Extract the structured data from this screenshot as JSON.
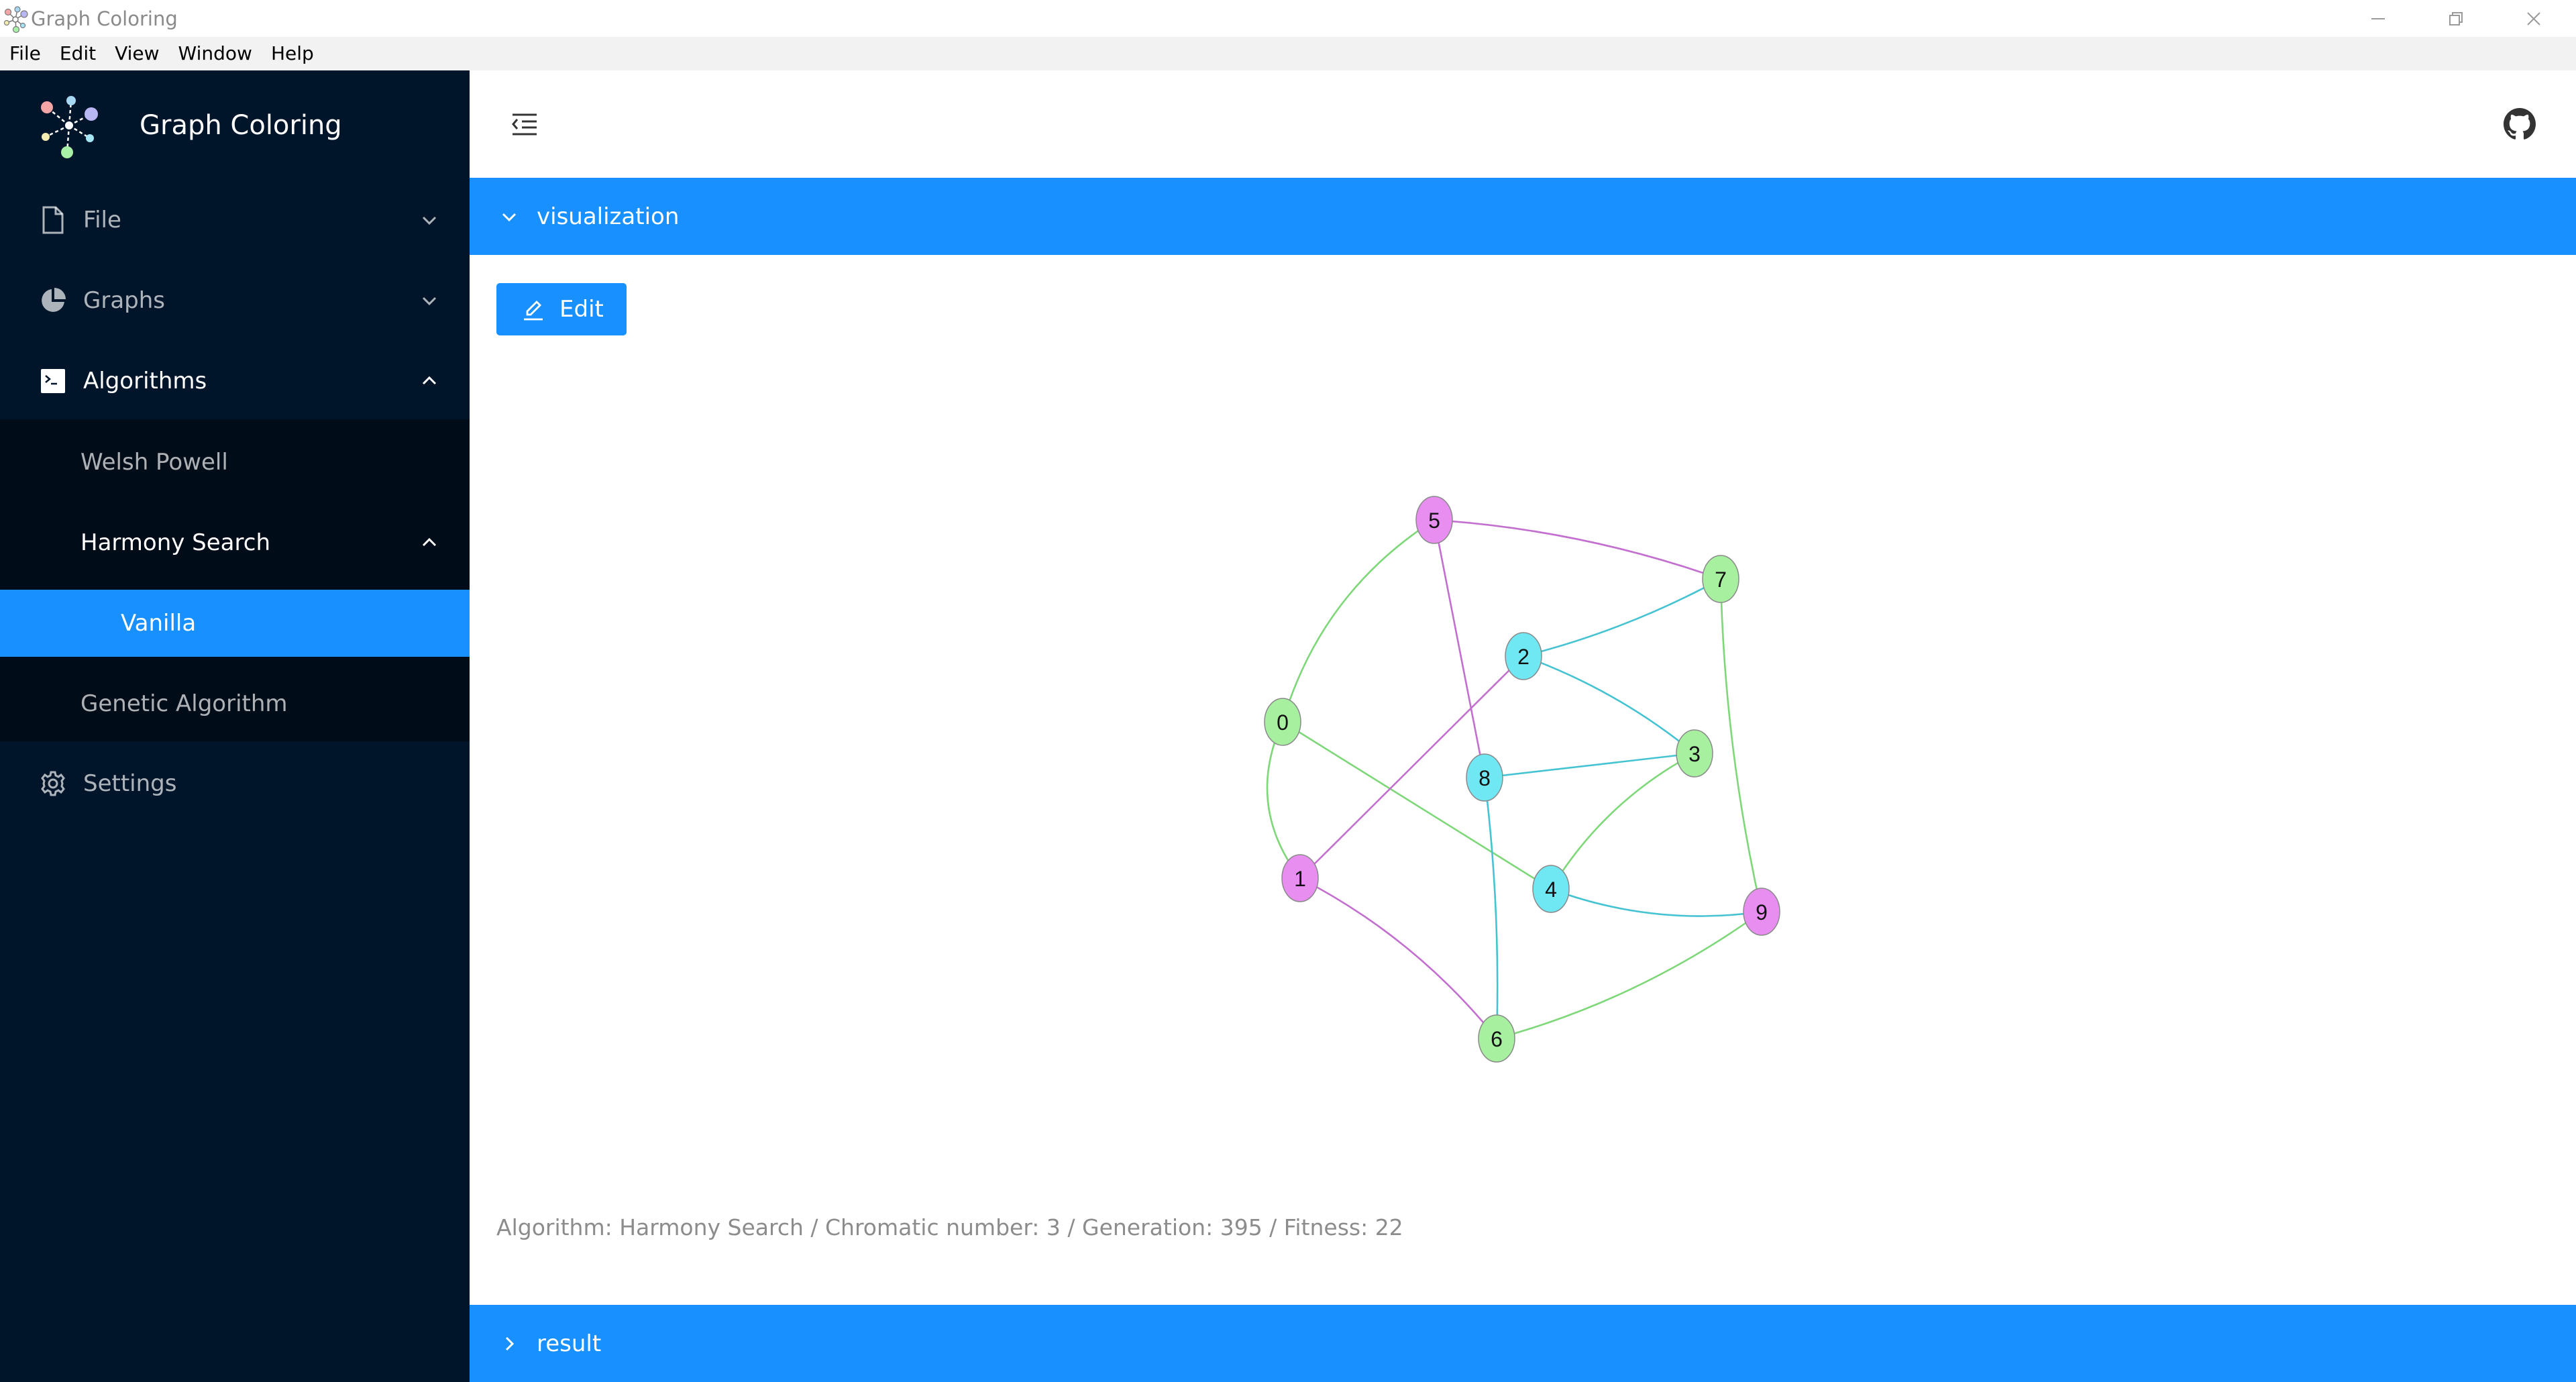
{
  "window": {
    "title": "Graph Coloring"
  },
  "menubar": {
    "items": [
      "File",
      "Edit",
      "View",
      "Window",
      "Help"
    ]
  },
  "sidebar": {
    "app_title": "Graph Coloring",
    "items": [
      {
        "label": "File",
        "icon": "file-icon"
      },
      {
        "label": "Graphs",
        "icon": "pie-chart-icon"
      },
      {
        "label": "Algorithms",
        "icon": "code-icon"
      },
      {
        "label": "Settings",
        "icon": "gear-icon"
      }
    ],
    "algorithms": {
      "welsh_powell": "Welsh Powell",
      "harmony_search": "Harmony Search",
      "vanilla": "Vanilla",
      "genetic_algorithm": "Genetic Algorithm"
    }
  },
  "content": {
    "visualization_label": "visualization",
    "edit_label": "Edit",
    "status": "Algorithm: Harmony Search / Chromatic number: 3 / Generation: 395 / Fitness: 22",
    "result_label": "result"
  },
  "colors": {
    "accent": "#1890ff",
    "sidebar_bg": "#001529",
    "submenu_bg": "#000c17",
    "magenta": "#e88ef0",
    "green": "#a7f0a0",
    "cyan": "#6fe8f3"
  },
  "graph": {
    "nodes": [
      {
        "id": "0",
        "color": "green"
      },
      {
        "id": "1",
        "color": "magenta"
      },
      {
        "id": "2",
        "color": "cyan"
      },
      {
        "id": "3",
        "color": "green"
      },
      {
        "id": "4",
        "color": "cyan"
      },
      {
        "id": "5",
        "color": "magenta"
      },
      {
        "id": "6",
        "color": "green"
      },
      {
        "id": "7",
        "color": "green"
      },
      {
        "id": "8",
        "color": "cyan"
      },
      {
        "id": "9",
        "color": "magenta"
      }
    ],
    "edges": [
      [
        "0",
        "5"
      ],
      [
        "0",
        "1"
      ],
      [
        "0",
        "4"
      ],
      [
        "1",
        "2"
      ],
      [
        "1",
        "6"
      ],
      [
        "5",
        "7"
      ],
      [
        "5",
        "8"
      ],
      [
        "2",
        "7"
      ],
      [
        "2",
        "3"
      ],
      [
        "8",
        "3"
      ],
      [
        "8",
        "6"
      ],
      [
        "3",
        "4"
      ],
      [
        "4",
        "9"
      ],
      [
        "7",
        "9"
      ],
      [
        "6",
        "9"
      ]
    ]
  }
}
